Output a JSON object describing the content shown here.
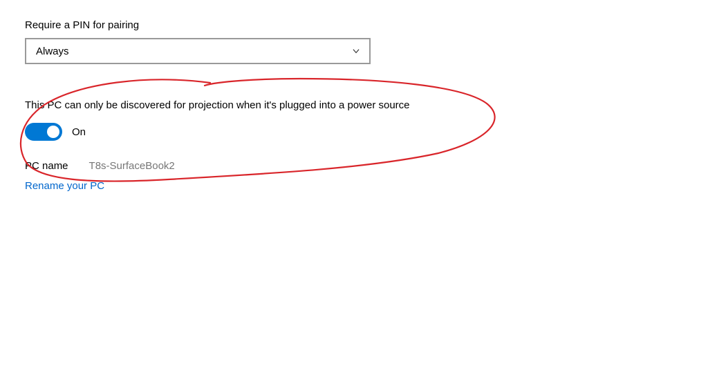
{
  "pin": {
    "label": "Require a PIN for pairing",
    "value": "Always"
  },
  "discovery": {
    "label": "This PC can only be discovered for projection when it's plugged into a power source",
    "toggle_state": "On"
  },
  "pc": {
    "label": "PC name",
    "value": "T8s-SurfaceBook2",
    "rename_link": "Rename your PC"
  },
  "colors": {
    "accent": "#0078d4",
    "link": "#0066cc",
    "annotation": "#d9252a"
  }
}
